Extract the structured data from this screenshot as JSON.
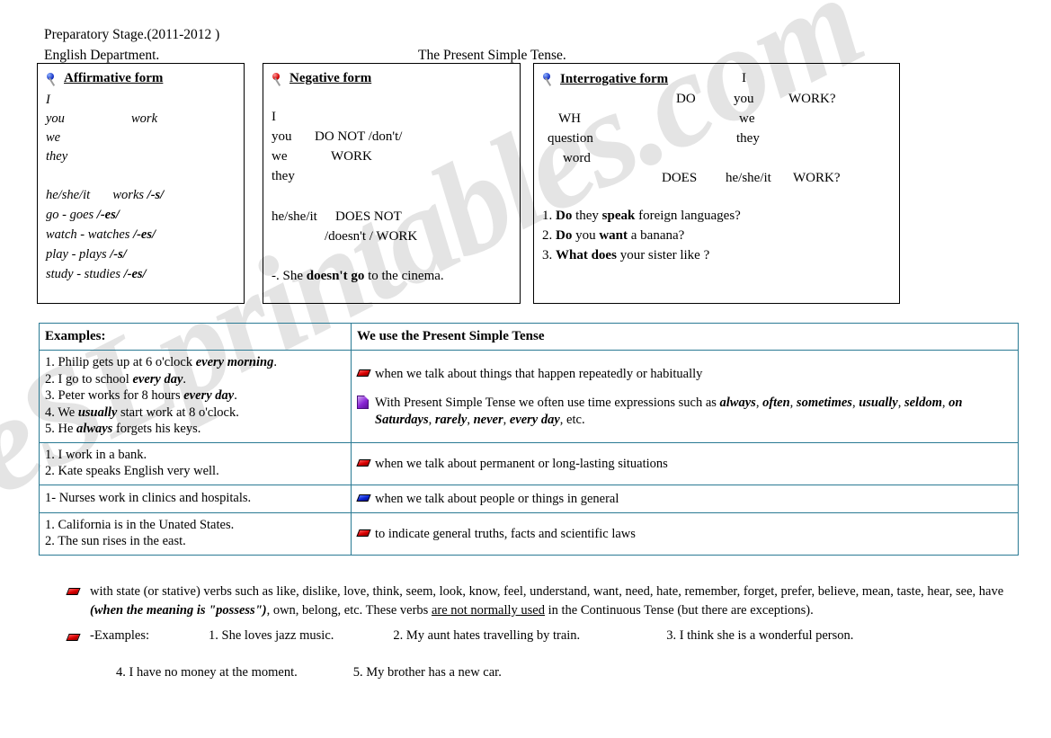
{
  "header": {
    "line1": "Preparatory Stage.(2011-2012 )",
    "line2": "English Department.",
    "title": "The Present Simple Tense."
  },
  "watermark": "eSLprintables.com",
  "colors": {
    "table_border": "#2a7a94",
    "box_border": "#000000",
    "pin_blue": "#1b37c8",
    "pin_red": "#d40000",
    "eraser_red": "#d90000",
    "eraser_blue": "#0b23d4",
    "page_purple": "#8a25d6"
  },
  "affirmative": {
    "heading": "Affirmative form",
    "pin": "pushpin-blue-icon",
    "subjects": [
      "I",
      "you",
      "we",
      "they"
    ],
    "verb": "work",
    "third_person": "he/she/it",
    "third_person_verb": "works",
    "third_person_ending": "/-s/",
    "spelling_rules": [
      {
        "text": "go - goes ",
        "ending": "/-es/"
      },
      {
        "text": "watch - watches ",
        "ending": "/-es/"
      },
      {
        "text": "play - plays ",
        "ending": "/-s/"
      },
      {
        "text": "study - studies ",
        "ending": "/-es/"
      }
    ]
  },
  "negative": {
    "heading": "Negative form",
    "pin": "pushpin-red-icon",
    "subjects": [
      "I",
      "you",
      "we",
      "they"
    ],
    "aux": "DO NOT /don't/",
    "verb": "WORK",
    "third_person": "he/she/it",
    "third_aux": "DOES NOT",
    "third_aux2": "/doesn't / WORK",
    "example_prefix": "-. She ",
    "example_bold1": "doesn't",
    "example_mid": "  ",
    "example_bold2": "go",
    "example_suffix": " to the cinema."
  },
  "interrogative": {
    "heading": "Interrogative form",
    "pin": "pushpin-blue-icon",
    "wh_lines": [
      "WH",
      "question",
      "word"
    ],
    "aux_do": "DO",
    "aux_does": "DOES",
    "subject_i": "I",
    "subjects": [
      "you",
      "we",
      "they"
    ],
    "third_person": "he/she/it",
    "verb_q": "WORK?",
    "examples": [
      {
        "num": "1.",
        "b1": "Do",
        "t1": " they ",
        "b2": "speak",
        "t2": " foreign languages?"
      },
      {
        "num": "2.",
        "b1": "Do",
        "t1": " you ",
        "b2": "want",
        "t2": " a banana?"
      },
      {
        "num": "3.",
        "b1": "What does",
        "t1": " your sister like ?",
        "b2": "",
        "t2": ""
      }
    ]
  },
  "table": {
    "col_a_header": "Examples:",
    "col_b_header": "We use the Present Simple Tense",
    "rows": [
      {
        "examples": [
          "1. Philip gets up at 6 o'clock <i>every morning</i>.",
          "2. I go to school <i>every day</i>.",
          "3. Peter works for 8 hours <i>every day</i>.",
          "4. We <i>usually</i> start work at 8 o'clock.",
          "5. He <i>always</i> forgets his keys."
        ],
        "uses": [
          {
            "icon": "eraser-red-icon",
            "text": "when we talk about things that happen repeatedly or habitually"
          },
          {
            "icon": "page-purple-icon",
            "text": "With Present Simple Tense we often use time expressions such as <i>always</i>, <i>often</i>, <i>sometimes</i>, <i>usually</i>, <i>seldom</i>, <i>on Saturdays</i>, <i>rarely</i>, <i>never</i>, <i>every day</i>, etc."
          }
        ]
      },
      {
        "examples": [
          "1. I work in a bank.",
          "2. Kate speaks English very well."
        ],
        "uses": [
          {
            "icon": "eraser-red-icon",
            "text": "when we talk about permanent or long-lasting situations"
          }
        ]
      },
      {
        "examples": [
          "1- Nurses work in clinics and hospitals."
        ],
        "uses": [
          {
            "icon": "eraser-blue-icon",
            "text": "when we talk about people or things in general"
          }
        ]
      },
      {
        "examples": [
          "1. California is in the Unated States.",
          "2. The sun rises in the east."
        ],
        "uses": [
          {
            "icon": "eraser-red-icon",
            "text": "to indicate general truths, facts and scientific laws"
          }
        ]
      }
    ]
  },
  "notes": {
    "stative": "with state (or stative) verbs such as like, dislike, love, think, seem, look, know, feel, understand, want, need, hate, remember, forget, prefer, believe, mean, taste, hear, see, have <i>(when the meaning is \"possess\")</i>, own, belong, etc. These verbs <u>are not normally used</u> in the Continuous Tense (but there are exceptions).",
    "examples_label": "-Examples:",
    "examples_line1": [
      "1. She loves jazz music.",
      "2. My aunt hates travelling by train.",
      "3. I think she is a wonderful person."
    ],
    "examples_line2": [
      "4. I have no money at the moment.",
      "5. My brother has a new car."
    ]
  }
}
